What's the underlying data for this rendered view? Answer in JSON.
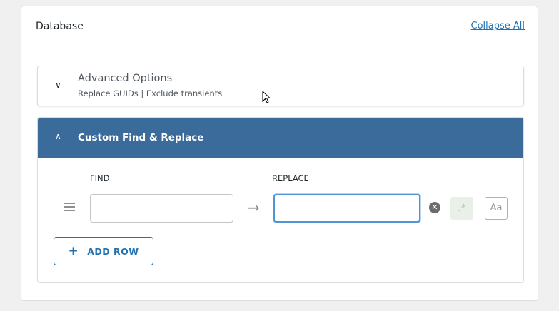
{
  "panel": {
    "title": "Database",
    "collapse_all": "Collapse All"
  },
  "advanced": {
    "title": "Advanced Options",
    "subtitle": "Replace GUIDs | Exclude transients"
  },
  "custom": {
    "title": "Custom Find & Replace",
    "find_label": "FIND",
    "replace_label": "REPLACE",
    "find_value": "",
    "replace_value": "",
    "regex_label": ".*",
    "case_label": "Aa",
    "add_row": "ADD ROW"
  },
  "colors": {
    "accent": "#3a6b9b",
    "link": "#2271b1"
  }
}
